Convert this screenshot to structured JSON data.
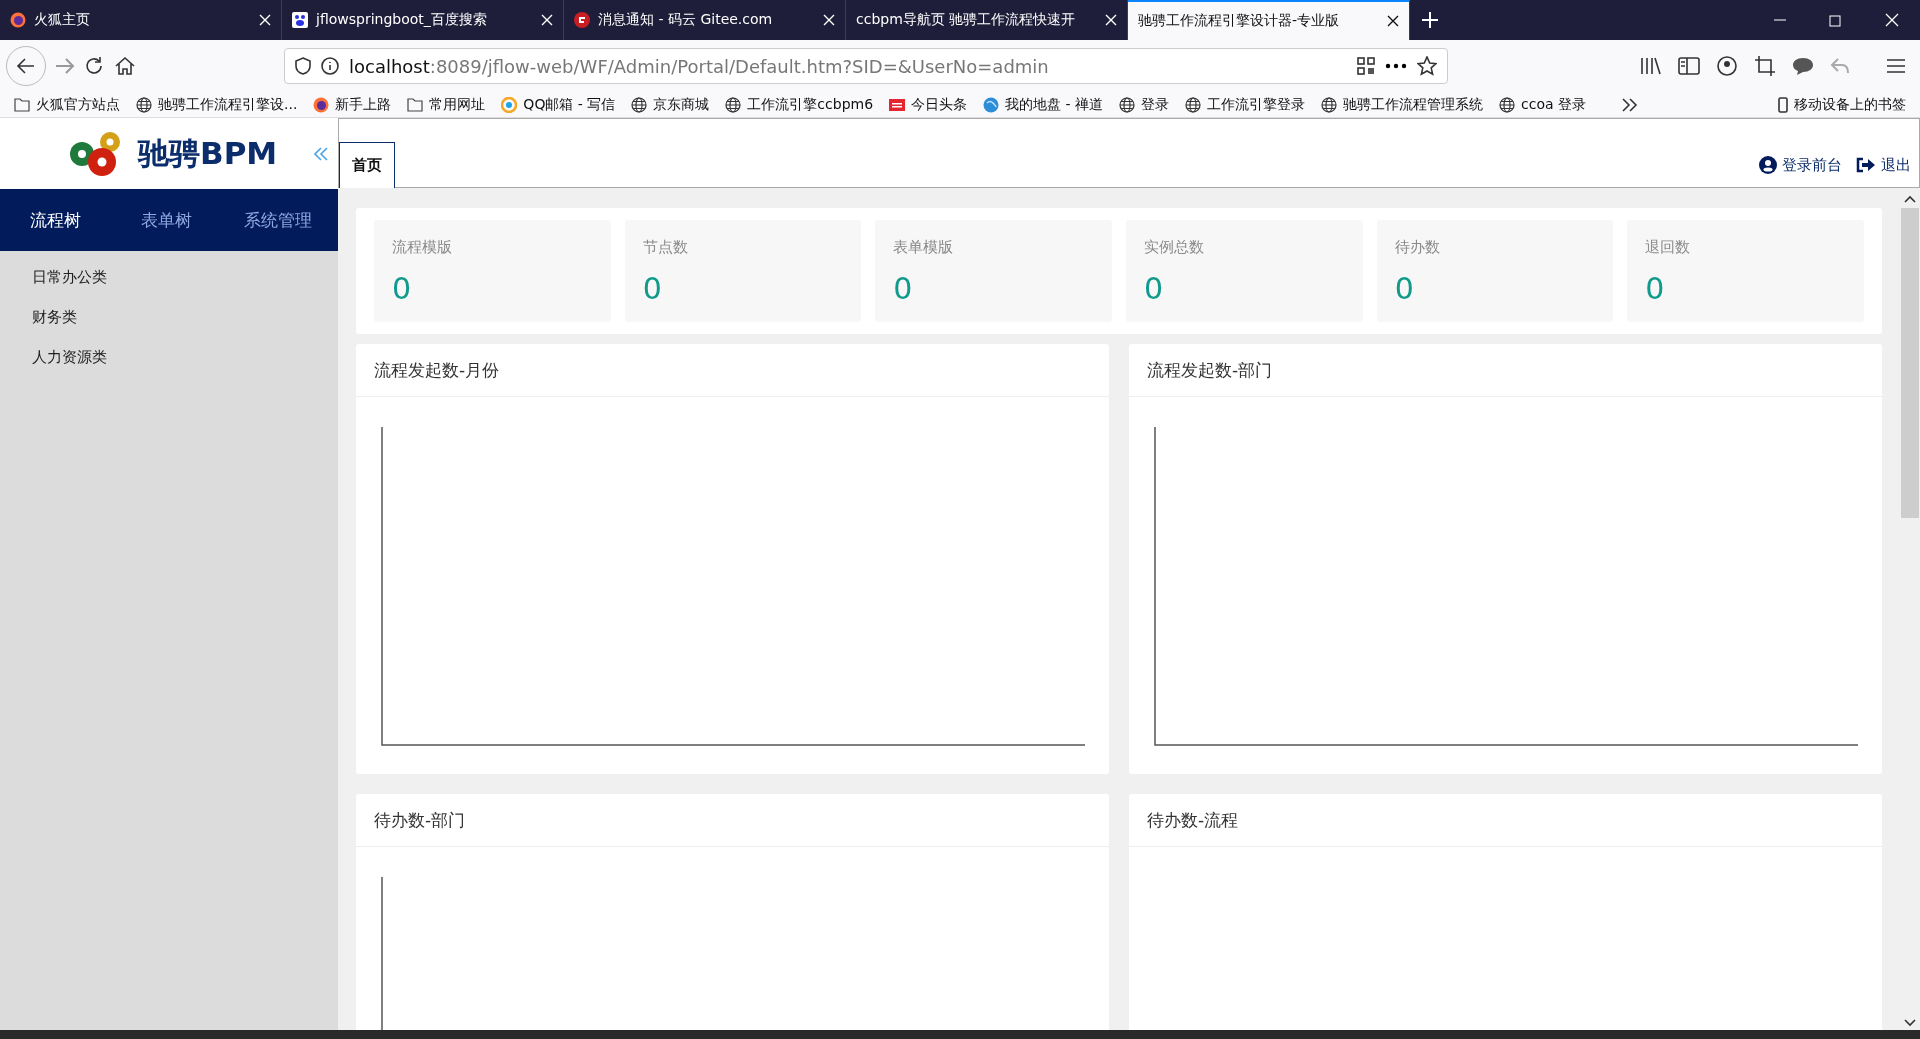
{
  "browser": {
    "tabs": [
      {
        "title": "火狐主页",
        "selected": false
      },
      {
        "title": "jflowspringboot_百度搜索",
        "selected": false
      },
      {
        "title": "消息通知 - 码云 Gitee.com",
        "selected": false
      },
      {
        "title": "ccbpm导航页 驰骋工作流程快速开",
        "selected": false
      },
      {
        "title": "驰骋工作流程引擎设计器-专业版",
        "selected": true
      }
    ],
    "address": {
      "host": "localhost",
      "rest": ":8089/jflow-web/WF/Admin/Portal/Default.htm?SID=&UserNo=admin"
    },
    "bookmarks": [
      {
        "label": "火狐官方站点"
      },
      {
        "label": "驰骋工作流程引擎设..."
      },
      {
        "label": "新手上路"
      },
      {
        "label": "常用网址"
      },
      {
        "label": "QQ邮箱 - 写信"
      },
      {
        "label": "京东商城"
      },
      {
        "label": "工作流引擎ccbpm6"
      },
      {
        "label": "今日头条"
      },
      {
        "label": "我的地盘 - 禅道"
      },
      {
        "label": "登录"
      },
      {
        "label": "工作流引擎登录"
      },
      {
        "label": "驰骋工作流程管理系统"
      },
      {
        "label": "ccoa 登录"
      }
    ],
    "mobile_bookmarks": "移动设备上的书签"
  },
  "app": {
    "logo": "驰骋BPM",
    "tabs": [
      {
        "label": "首页",
        "selected": true
      }
    ],
    "header_links": [
      {
        "label": "登录前台"
      },
      {
        "label": "退出"
      }
    ],
    "sidebar": {
      "tabs": [
        {
          "label": "流程树",
          "selected": true
        },
        {
          "label": "表单树",
          "selected": false
        },
        {
          "label": "系统管理",
          "selected": false
        }
      ],
      "items": [
        {
          "label": "日常办公类"
        },
        {
          "label": "财务类"
        },
        {
          "label": "人力资源类"
        }
      ]
    },
    "stats": [
      {
        "label": "流程模版",
        "value": "0"
      },
      {
        "label": "节点数",
        "value": "0"
      },
      {
        "label": "表单模版",
        "value": "0"
      },
      {
        "label": "实例总数",
        "value": "0"
      },
      {
        "label": "待办数",
        "value": "0"
      },
      {
        "label": "退回数",
        "value": "0"
      }
    ],
    "panels": [
      {
        "title": "流程发起数-月份"
      },
      {
        "title": "流程发起数-部门"
      },
      {
        "title": "待办数-部门"
      },
      {
        "title": "待办数-流程"
      }
    ]
  }
}
